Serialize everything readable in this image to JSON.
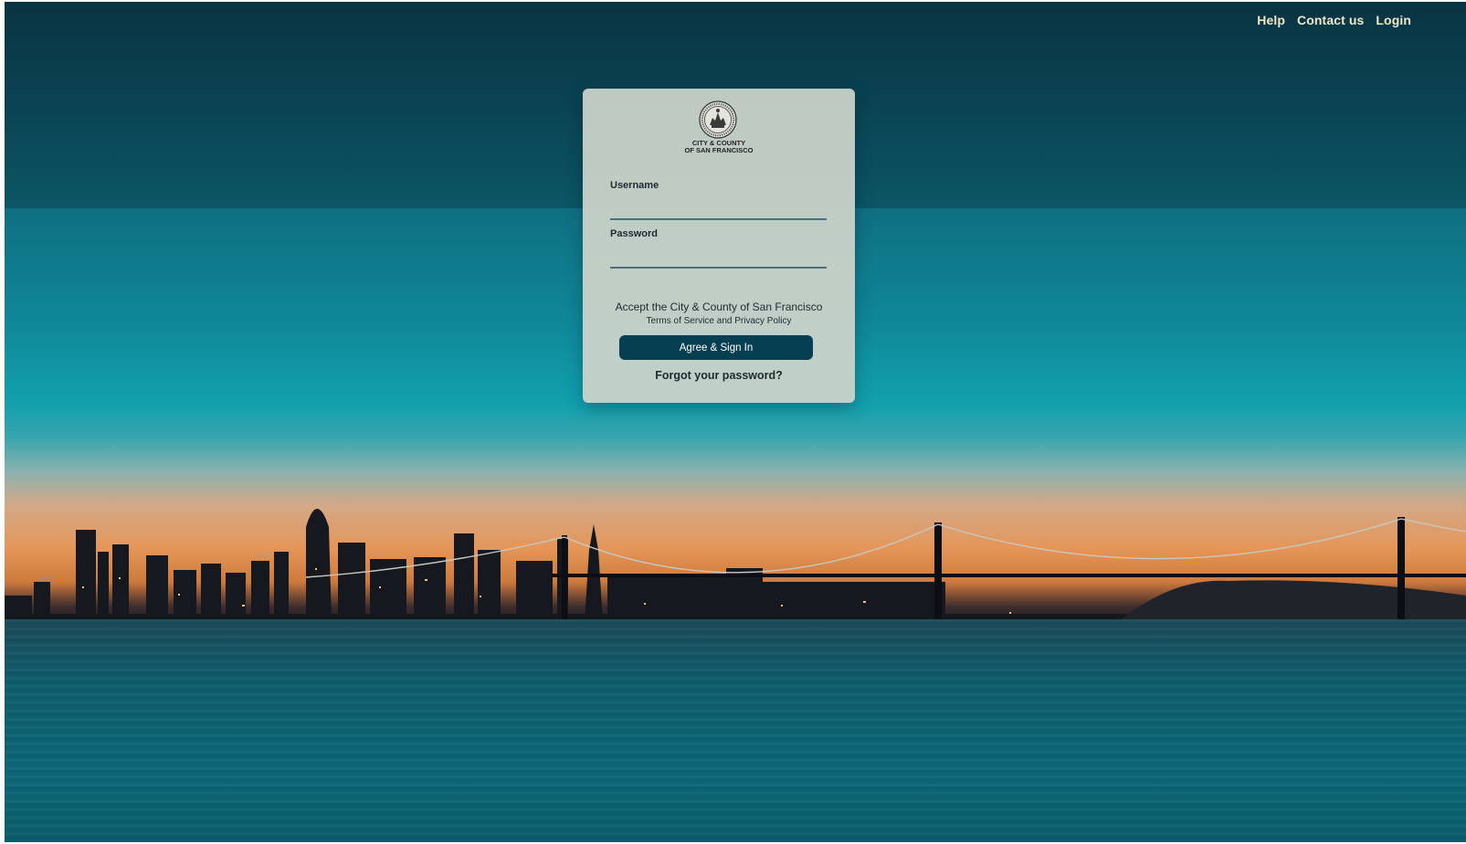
{
  "topnav": {
    "help": "Help",
    "contact": "Contact us",
    "login": "Login"
  },
  "logo": {
    "icon": "city-seal-icon",
    "line1": "CITY & COUNTY",
    "line2": "OF SAN FRANCISCO"
  },
  "form": {
    "username_label": "Username",
    "username_value": "",
    "password_label": "Password",
    "password_value": "",
    "terms_line1": "Accept the City & County of San Francisco",
    "terms_line2": "Terms of Service and Privacy Policy",
    "submit_label": "Agree & Sign In",
    "forgot_label": "Forgot your password?"
  },
  "colors": {
    "button": "#063f52",
    "nav_text": "#f1e7c8",
    "card": "#cdd4ca"
  }
}
